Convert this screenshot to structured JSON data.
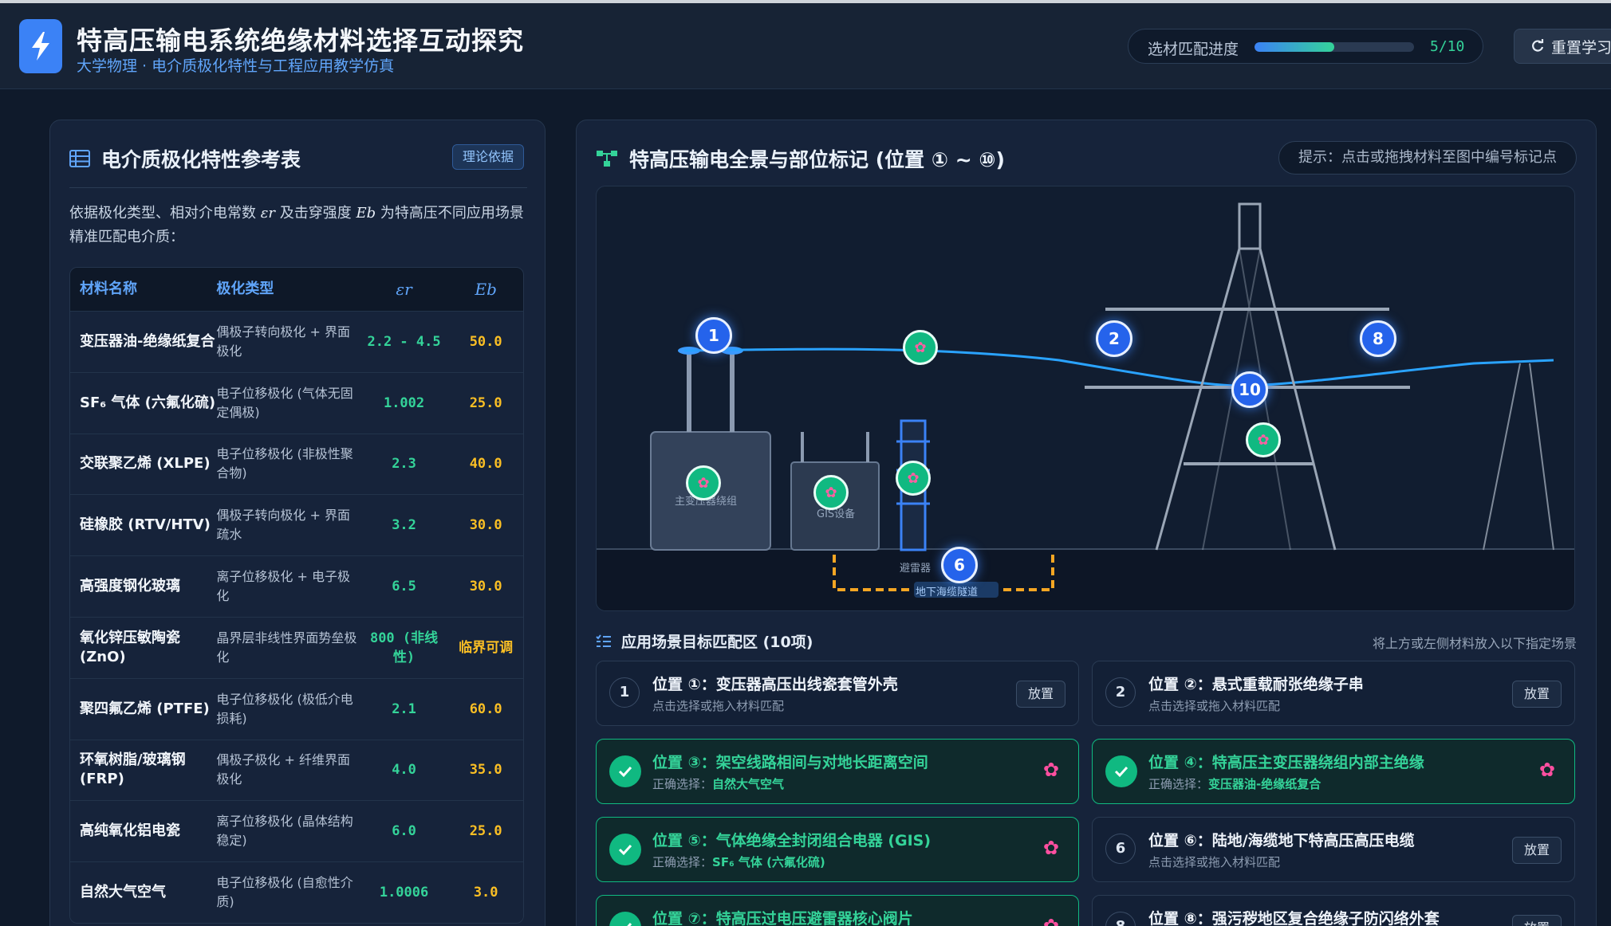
{
  "app": {
    "title": "特高压输电系统绝缘材料选择互动探究",
    "subtitle": "大学物理 · 电介质极化特性与工程应用教学仿真",
    "progress_label": "选材匹配进度",
    "progress_text": "5/10",
    "progress_fraction": 0.5,
    "reset_label": "重置学习"
  },
  "left": {
    "title": "电介质极化特性参考表",
    "tag": "理论依据",
    "intro_a": "依据极化类型、相对介电常数 ",
    "intro_er": "εr",
    "intro_b": " 及击穿强度 ",
    "intro_eb": "Eb",
    "intro_c": " 为特高压不同应用场景精准匹配电介质：",
    "headers": [
      "材料名称",
      "极化类型",
      "εr",
      "Eb"
    ],
    "rows": [
      {
        "name": "变压器油-绝缘纸复合",
        "type": "偶极子转向极化 + 界面极化",
        "er": "2.2 - 4.5",
        "eb": "50.0"
      },
      {
        "name": "SF₆ 气体 (六氟化硫)",
        "type": "电子位移极化 (气体无固定偶极)",
        "er": "1.002",
        "eb": "25.0"
      },
      {
        "name": "交联聚乙烯 (XLPE)",
        "type": "电子位移极化 (非极性聚合物)",
        "er": "2.3",
        "eb": "40.0"
      },
      {
        "name": "硅橡胶 (RTV/HTV)",
        "type": "偶极子转向极化 + 界面疏水",
        "er": "3.2",
        "eb": "30.0"
      },
      {
        "name": "高强度钢化玻璃",
        "type": "离子位移极化 + 电子极化",
        "er": "6.5",
        "eb": "30.0"
      },
      {
        "name": "氧化锌压敏陶瓷 (ZnO)",
        "type": "晶界层非线性界面势垒极化",
        "er": "800 (非线性)",
        "eb": "临界可调"
      },
      {
        "name": "聚四氟乙烯 (PTFE)",
        "type": "电子位移极化 (极低介电损耗)",
        "er": "2.1",
        "eb": "60.0"
      },
      {
        "name": "环氧树脂/玻璃钢 (FRP)",
        "type": "偶极子极化 + 纤维界面极化",
        "er": "4.0",
        "eb": "35.0"
      },
      {
        "name": "高纯氧化铝电瓷",
        "type": "离子位移极化 (晶体结构稳定)",
        "er": "6.0",
        "eb": "25.0"
      },
      {
        "name": "自然大气空气",
        "type": "电子位移极化 (自愈性介质)",
        "er": "1.0006",
        "eb": "3.0"
      }
    ]
  },
  "right": {
    "title": "特高压输电全景与部位标记 (位置 ① ~ ⑩)",
    "hint": "提示：点击或拖拽材料至图中编号标记点",
    "scene_labels": {
      "transformer": "主变压器绕组",
      "gis": "GIS设备",
      "arrester": "避雷器",
      "cable": "地下海缆隧道"
    },
    "markers": [
      "1",
      "2",
      "8",
      "10",
      "6"
    ],
    "zone_title": "应用场景目标匹配区 (10项)",
    "zone_hint": "将上方或左侧材料放入以下指定场景",
    "place_label": "放置",
    "correct_prefix": "正确选择：",
    "cards": [
      {
        "num": "1",
        "title": "位置 ①：变压器高压出线瓷套管外壳",
        "sub": "点击选择或拖入材料匹配",
        "done": false
      },
      {
        "num": "2",
        "title": "位置 ②：悬式重载耐张绝缘子串",
        "sub": "点击选择或拖入材料匹配",
        "done": false
      },
      {
        "num": "3",
        "title": "位置 ③：架空线路相间与对地长距离空间",
        "sub": "自然大气空气",
        "done": true
      },
      {
        "num": "4",
        "title": "位置 ④：特高压主变压器绕组内部主绝缘",
        "sub": "变压器油-绝缘纸复合",
        "done": true
      },
      {
        "num": "5",
        "title": "位置 ⑤：气体绝缘全封闭组合电器 (GIS)",
        "sub": "SF₆ 气体 (六氟化硫)",
        "done": true
      },
      {
        "num": "6",
        "title": "位置 ⑥：陆地/海缆地下特高压高压电缆",
        "sub": "点击选择或拖入材料匹配",
        "done": false
      },
      {
        "num": "7",
        "title": "位置 ⑦：特高压过电压避雷器核心阀片",
        "sub": "",
        "done": true
      },
      {
        "num": "8",
        "title": "位置 ⑧：强污秽地区复合绝缘子防闪络外套",
        "sub": "",
        "done": false
      }
    ],
    "flower_glyph": "✿"
  },
  "colors": {
    "accent": "#3b82f6",
    "success": "#10b981",
    "warning": "#fbbf24",
    "background": "#0f1a2b"
  }
}
